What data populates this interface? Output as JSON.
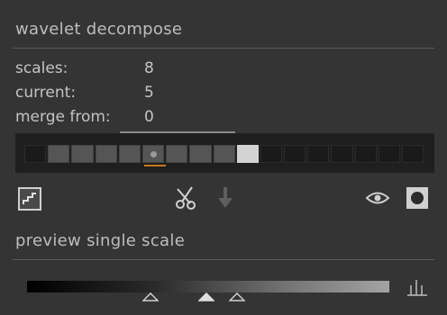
{
  "wavelet": {
    "title": "wavelet decompose",
    "scales_label": "scales:",
    "scales_value": "8",
    "current_label": "current:",
    "current_value": "5",
    "merge_label": "merge from:",
    "merge_value": "0",
    "strip": {
      "cell_count": 17,
      "filled_cells": 9,
      "current_cell": 5,
      "highlight_cell": 9
    }
  },
  "toolbar": {
    "icons": [
      "steps-icon",
      "scissors-icon",
      "arrow-down-icon",
      "eye-icon",
      "mask-icon"
    ]
  },
  "preview": {
    "title": "preview single scale"
  },
  "colors": {
    "background": "#343434",
    "strip_background": "#1f1f1f",
    "cell_filled": "#555555",
    "cell_empty": "#1a1a1a",
    "cell_highlight": "#d3d3d3",
    "current_underline": "#c67a18"
  }
}
